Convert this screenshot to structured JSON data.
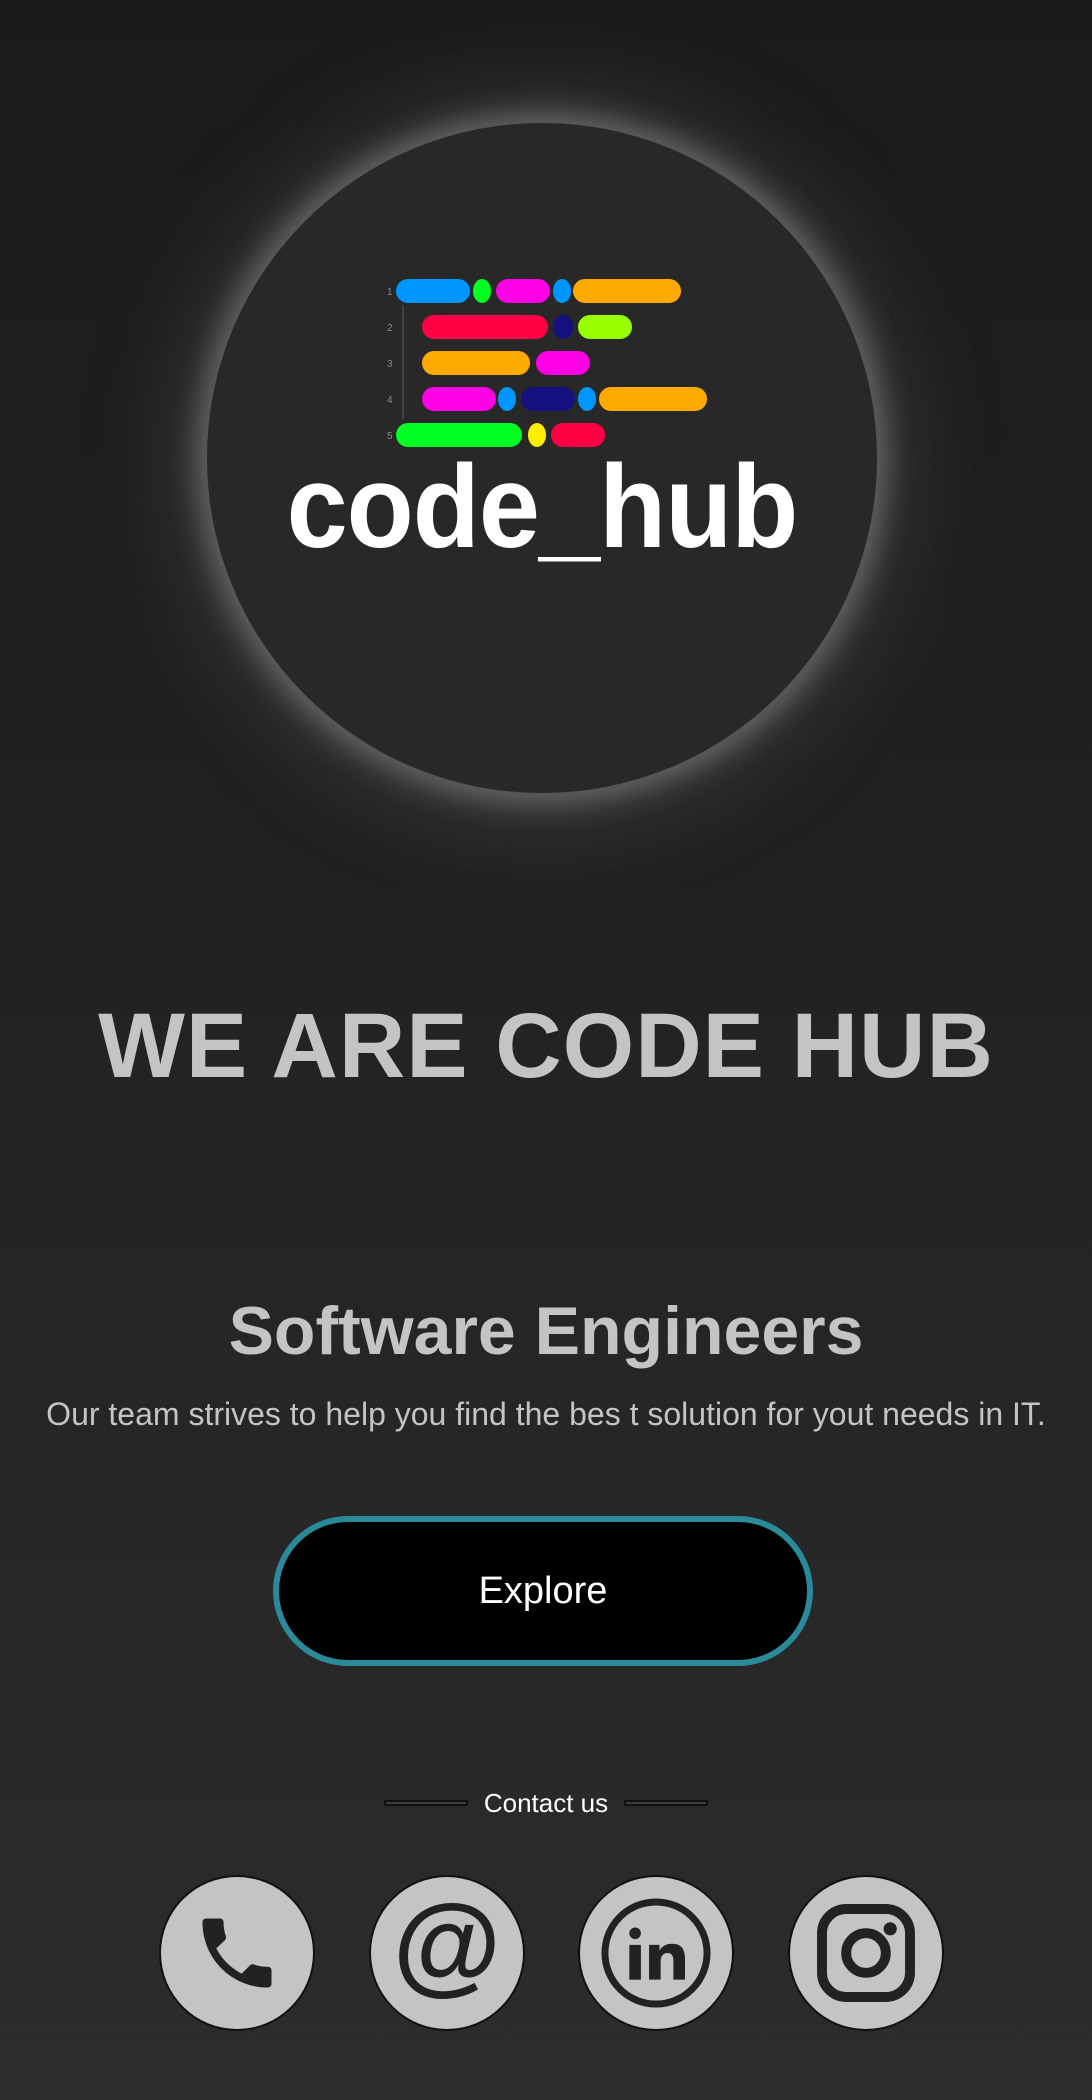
{
  "logo": {
    "wordmark": "code_hub",
    "line_numbers": [
      "1",
      "2",
      "3",
      "4",
      "5"
    ],
    "code_colors": {
      "blue": "#0096ff",
      "green": "#00ff22",
      "magenta": "#ff00e6",
      "orange": "#ffaa00",
      "red": "#ff0044",
      "navy": "#141080",
      "lime": "#99ff00",
      "yellow": "#ffee00"
    }
  },
  "hero": {
    "headline": "WE ARE CODE HUB",
    "subtitle": "Software Engineers",
    "tagline": "Our team strives to help you find the bes t solution for yout needs in IT.",
    "explore_label": "Explore"
  },
  "contact": {
    "label": "Contact us",
    "icons": [
      "phone-icon",
      "at-sign-icon",
      "linkedin-icon",
      "instagram-icon"
    ]
  },
  "colors": {
    "accent_border": "#2a8a9a",
    "text_gray": "#c4c4c4",
    "background": "#1f1f1f"
  }
}
